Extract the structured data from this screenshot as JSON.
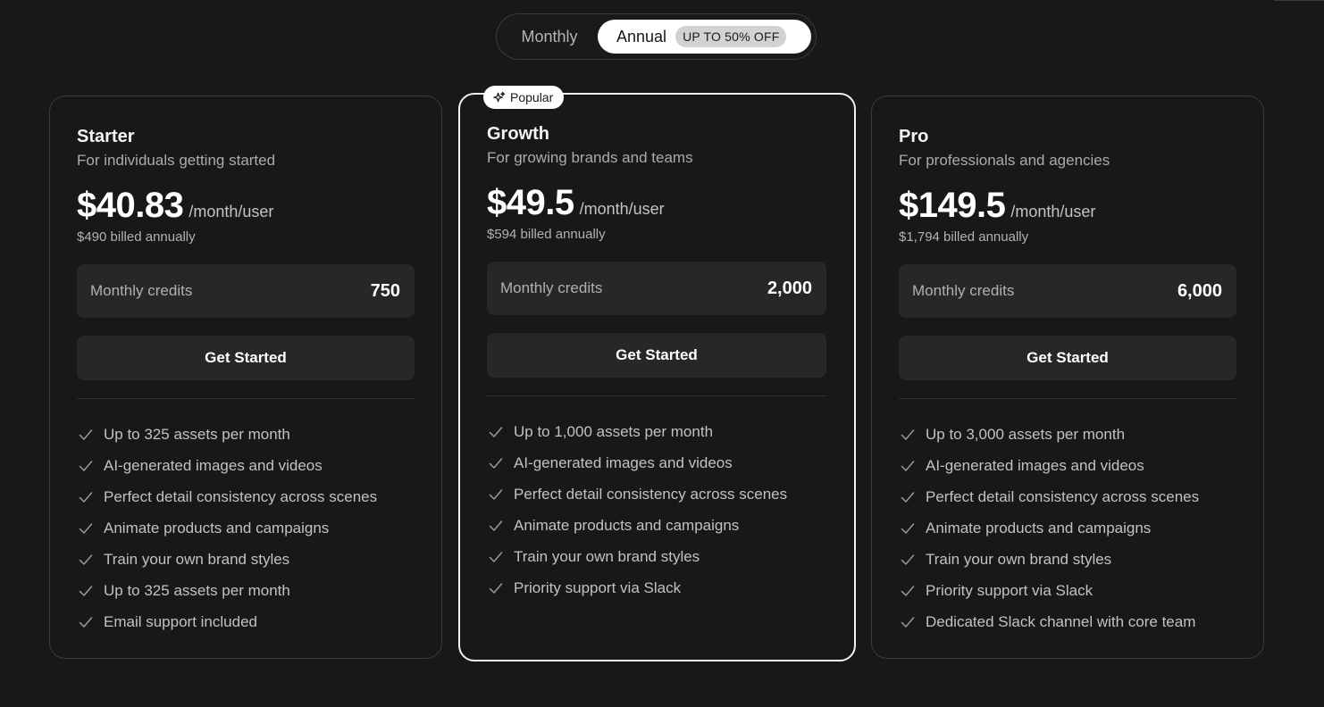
{
  "billing_toggle": {
    "monthly_label": "Monthly",
    "annual_label": "Annual",
    "annual_badge": "UP TO 50% OFF",
    "selected": "Annual"
  },
  "plans": [
    {
      "name": "Starter",
      "description": "For individuals getting started",
      "price": "$40.83",
      "price_unit": "/month/user",
      "billed": "$490 billed annually",
      "credits_label": "Monthly credits",
      "credits_value": "750",
      "cta_label": "Get Started",
      "features": [
        "Up to 325 assets per month",
        "AI-generated images and videos",
        "Perfect detail consistency across scenes",
        "Animate products and campaigns",
        "Train your own brand styles",
        "Up to 325 assets per month",
        "Email support included"
      ]
    },
    {
      "name": "Growth",
      "description": "For growing brands and teams",
      "badge": "Popular",
      "price": "$49.5",
      "price_unit": "/month/user",
      "billed": "$594 billed annually",
      "credits_label": "Monthly credits",
      "credits_value": "2,000",
      "cta_label": "Get Started",
      "features": [
        "Up to 1,000 assets per month",
        "AI-generated images and videos",
        "Perfect detail consistency across scenes",
        "Animate products and campaigns",
        "Train your own brand styles",
        "Priority support via Slack"
      ]
    },
    {
      "name": "Pro",
      "description": "For professionals and agencies",
      "price": "$149.5",
      "price_unit": "/month/user",
      "billed": "$1,794 billed annually",
      "credits_label": "Monthly credits",
      "credits_value": "6,000",
      "cta_label": "Get Started",
      "features": [
        "Up to 3,000 assets per month",
        "AI-generated images and videos",
        "Perfect detail consistency across scenes",
        "Animate products and campaigns",
        "Train your own brand styles",
        "Priority support via Slack",
        "Dedicated Slack channel with core team"
      ]
    }
  ],
  "icons": {
    "feature": "check-icon",
    "popular": "sparkle-icon"
  },
  "colors": {
    "background": "#181818",
    "card_border": "#3b3b3b",
    "featured_border": "#f2f2f2",
    "surface": "#272727",
    "text_primary": "#ffffff",
    "text_muted": "#b0b0b0"
  }
}
